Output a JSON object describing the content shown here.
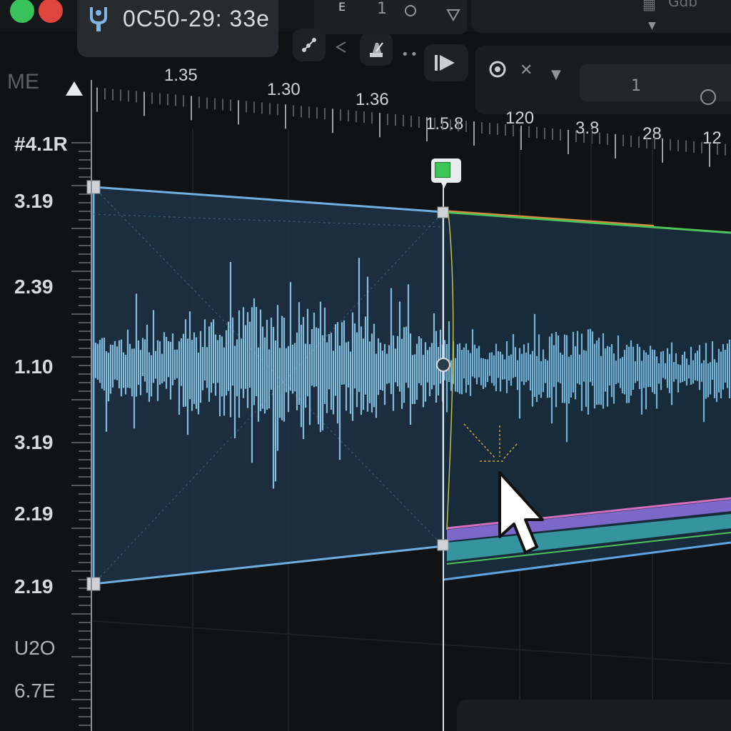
{
  "window": {
    "traffic_lights": [
      "green",
      "red"
    ],
    "timecode": "0C50-29: 33e",
    "app_icon": "tuning-fork-icon"
  },
  "toolbar": {
    "tool_labels": [
      "E",
      "1"
    ],
    "right_header_label": "Gdb"
  },
  "transport": {
    "buttons": [
      "node-graph-icon",
      "back-icon",
      "metronome-icon",
      "more-dots-icon",
      "play-icon"
    ]
  },
  "inspector": {
    "field_value": "1"
  },
  "track": {
    "label": "ME"
  },
  "ruler": {
    "labels": [
      "1.35",
      "1.30",
      "1.36",
      "1.5.8",
      "120",
      "3.8",
      "28",
      "12"
    ]
  },
  "scale": {
    "labels": [
      "#4.1R",
      "3.19",
      "2.39",
      "1.10",
      "3.19",
      "2.19",
      "2.19",
      "U2O",
      "6.7E"
    ]
  },
  "colors": {
    "accent_blue": "#6fb0e0",
    "waveform": "#8fcdf0",
    "marker_green": "#3cc65a",
    "automation_green": "#4cc45a",
    "automation_orange": "#e08a3c",
    "automation_pink": "#d46fc0",
    "automation_cyan": "#3fb8c0"
  }
}
